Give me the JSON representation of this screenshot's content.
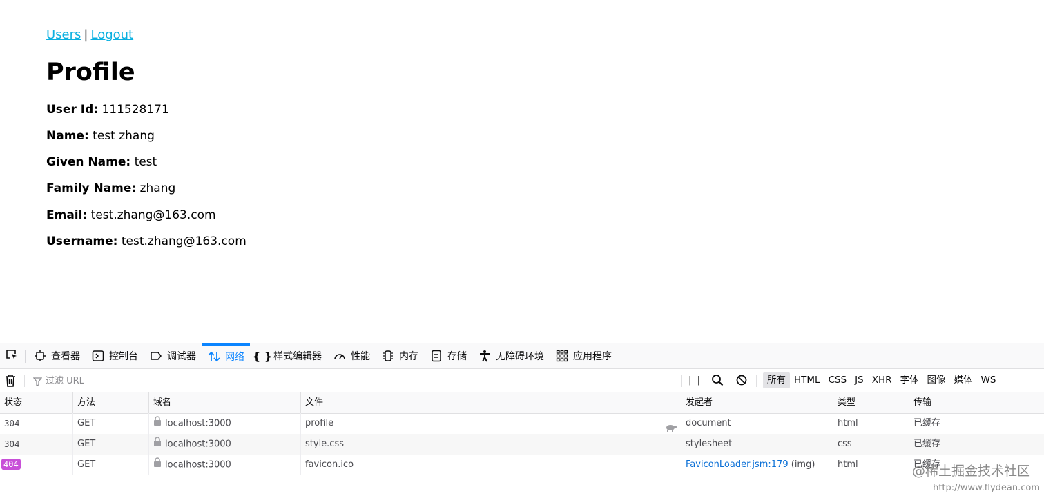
{
  "nav": {
    "users_link": "Users",
    "separator": "|",
    "logout_link": "Logout"
  },
  "page_title": "Profile",
  "fields": [
    {
      "label": "User Id:",
      "value": "111528171"
    },
    {
      "label": "Name:",
      "value": "test zhang"
    },
    {
      "label": "Given Name:",
      "value": "test"
    },
    {
      "label": "Family Name:",
      "value": "zhang"
    },
    {
      "label": "Email:",
      "value": "test.zhang@163.com"
    },
    {
      "label": "Username:",
      "value": "test.zhang@163.com"
    }
  ],
  "devtools": {
    "tabs": [
      {
        "label": "查看器",
        "icon": "inspector-icon"
      },
      {
        "label": "控制台",
        "icon": "console-icon"
      },
      {
        "label": "调试器",
        "icon": "debugger-icon"
      },
      {
        "label": "网络",
        "icon": "network-icon",
        "active": true
      },
      {
        "label": "样式编辑器",
        "icon": "style-editor-icon"
      },
      {
        "label": "性能",
        "icon": "performance-icon"
      },
      {
        "label": "内存",
        "icon": "memory-icon"
      },
      {
        "label": "存储",
        "icon": "storage-icon"
      },
      {
        "label": "无障碍环境",
        "icon": "accessibility-icon"
      },
      {
        "label": "应用程序",
        "icon": "application-icon"
      }
    ],
    "filter_placeholder": "过滤 URL",
    "pause_label": "| |",
    "type_filters": [
      "所有",
      "HTML",
      "CSS",
      "JS",
      "XHR",
      "字体",
      "图像",
      "媒体",
      "WS"
    ],
    "columns": [
      "状态",
      "方法",
      "域名",
      "文件",
      "发起者",
      "类型",
      "传输"
    ],
    "rows": [
      {
        "status": "304",
        "method": "GET",
        "domain": "localhost:3000",
        "file": "profile",
        "initiator": "document",
        "initiator_extra": "",
        "type": "html",
        "transfer": "已缓存",
        "error": false
      },
      {
        "status": "304",
        "method": "GET",
        "domain": "localhost:3000",
        "file": "style.css",
        "initiator": "stylesheet",
        "initiator_extra": "",
        "type": "css",
        "transfer": "已缓存",
        "error": false
      },
      {
        "status": "404",
        "method": "GET",
        "domain": "localhost:3000",
        "file": "favicon.ico",
        "initiator": "FaviconLoader.jsm:179",
        "initiator_extra": "(img)",
        "type": "html",
        "transfer": "已缓存",
        "error": true
      }
    ]
  },
  "watermark": {
    "line1": "@稀土掘金技术社区",
    "line2": "http://www.flydean.com"
  },
  "colors": {
    "link": "#0ab0e0",
    "devtools_active": "#0a84ff",
    "status_404_badge": "#c850d8"
  }
}
